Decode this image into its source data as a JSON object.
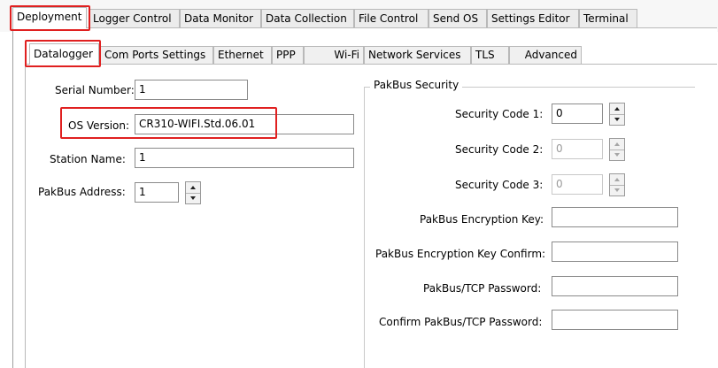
{
  "tabs": [
    "Deployment",
    "Logger Control",
    "Data Monitor",
    "Data Collection",
    "File Control",
    "Send OS",
    "Settings Editor",
    "Terminal"
  ],
  "subtabs": [
    "Datalogger",
    "Com Ports Settings",
    "Ethernet",
    "PPP",
    "Wi-Fi",
    "Network Services",
    "TLS",
    "Advanced"
  ],
  "datalogger": {
    "serial_number": {
      "label": "Serial Number:",
      "value": "1"
    },
    "os_version": {
      "label": "OS Version:",
      "value": "CR310-WIFI.Std.06.01"
    },
    "station_name": {
      "label": "Station Name:",
      "value": "1"
    },
    "pakbus_address": {
      "label": "PakBus Address:",
      "value": "1"
    }
  },
  "security": {
    "title": "PakBus Security",
    "code1": {
      "label": "Security Code 1:",
      "value": "0"
    },
    "code2": {
      "label": "Security Code 2:",
      "value": "0"
    },
    "code3": {
      "label": "Security Code 3:",
      "value": "0"
    },
    "enc_key": {
      "label": "PakBus Encryption Key:",
      "value": ""
    },
    "enc_key_confirm": {
      "label": "PakBus Encryption Key Confirm:",
      "value": ""
    },
    "tcp_password": {
      "label": "PakBus/TCP Password:",
      "value": ""
    },
    "tcp_password_confirm": {
      "label": "Confirm PakBus/TCP Password:",
      "value": ""
    }
  },
  "colors": {
    "highlight": "#e02020",
    "border": "#b9b9b9"
  },
  "icons": {
    "spin_up": "spin-up-arrow-icon",
    "spin_down": "spin-down-arrow-icon"
  }
}
